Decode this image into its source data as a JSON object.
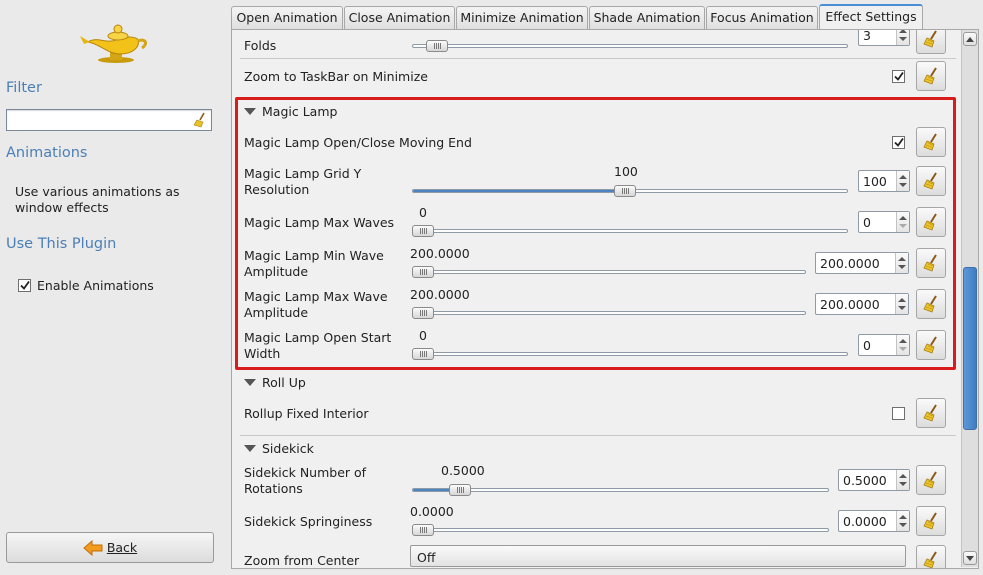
{
  "left": {
    "filter_heading": "Filter",
    "filter_value": "",
    "animations_heading": "Animations",
    "description_line1": "Use various animations as",
    "description_line2": "window effects",
    "use_plugin_heading": "Use This Plugin",
    "enable_label": "Enable Animations",
    "enable_checked": true,
    "back_label": "Back"
  },
  "tabs": [
    {
      "label": "Open Animation"
    },
    {
      "label": "Close Animation"
    },
    {
      "label": "Minimize Animation"
    },
    {
      "label": "Shade Animation"
    },
    {
      "label": "Focus Animation"
    },
    {
      "label": "Effect Settings",
      "active": true
    }
  ],
  "settings": {
    "folds": {
      "label": "Folds",
      "value": "3"
    },
    "zoom_taskbar": {
      "label": "Zoom to TaskBar on Minimize",
      "checked": true
    },
    "magic_lamp": {
      "title": "Magic Lamp",
      "moving_end": {
        "label": "Magic Lamp Open/Close Moving End",
        "checked": true
      },
      "grid_y": {
        "label_line1": "Magic Lamp Grid Y",
        "label_line2": "Resolution",
        "value": "100",
        "slider_fraction": 0.49
      },
      "max_waves": {
        "label": "Magic Lamp Max Waves",
        "value": "0",
        "slider_fraction": 0.0
      },
      "min_amp": {
        "label_line1": "Magic Lamp Min Wave",
        "label_line2": "Amplitude",
        "value": "200.0000",
        "slider_fraction": 0.0
      },
      "max_amp": {
        "label_line1": "Magic Lamp Max Wave",
        "label_line2": "Amplitude",
        "value": "200.0000",
        "slider_fraction": 0.0
      },
      "open_start_width": {
        "label_line1": "Magic Lamp Open Start",
        "label_line2": "Width",
        "value": "0",
        "slider_fraction": 0.0
      }
    },
    "roll_up": {
      "title": "Roll Up",
      "fixed_interior": {
        "label": "Rollup Fixed Interior",
        "checked": false
      }
    },
    "sidekick": {
      "title": "Sidekick",
      "rotations": {
        "label_line1": "Sidekick Number of",
        "label_line2": "Rotations",
        "value": "0.5000",
        "slider_fraction": 0.1
      },
      "springiness": {
        "label": "Sidekick Springiness",
        "value": "0.0000",
        "slider_fraction": 0.0
      },
      "zoom_center": {
        "label": "Zoom from Center",
        "value": "Off"
      }
    }
  },
  "colors": {
    "accent": "#4a8fd5",
    "highlight": "#d81b1b",
    "heading": "#4b7fb5"
  }
}
